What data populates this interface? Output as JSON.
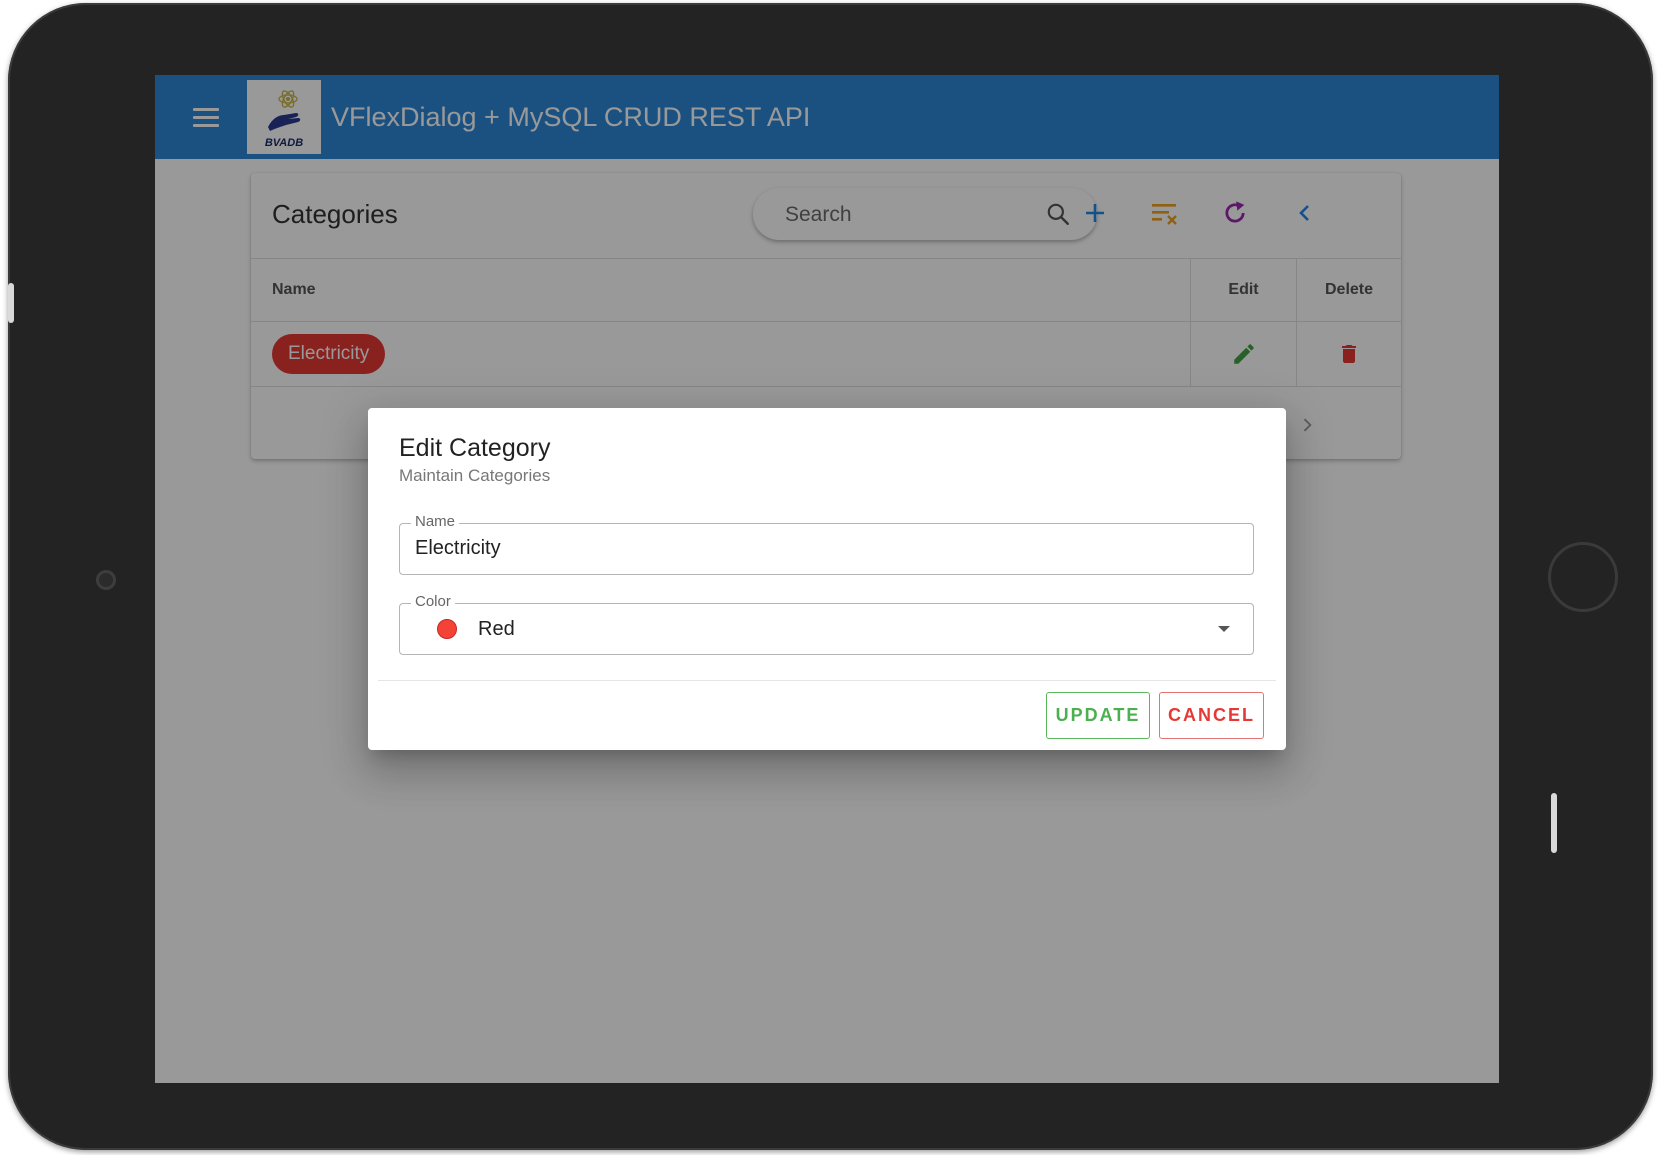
{
  "app_bar": {
    "title": "VFlexDialog + MySQL CRUD REST API",
    "logo_text": "BVADB",
    "accent": "#2e88d6"
  },
  "card": {
    "title": "Categories",
    "search": {
      "placeholder": "Search",
      "value": ""
    },
    "toolbar_icons": [
      "add-icon",
      "filter-clear-icon",
      "refresh-icon",
      "chevron-left-icon"
    ],
    "table": {
      "columns": {
        "name": "Name",
        "edit": "Edit",
        "delete": "Delete"
      },
      "rows": [
        {
          "name": "Electricity",
          "color": "#e53935"
        }
      ]
    }
  },
  "dialog": {
    "title": "Edit Category",
    "subtitle": "Maintain Categories",
    "name_field": {
      "label": "Name",
      "value": "Electricity"
    },
    "color_field": {
      "label": "Color",
      "value": "Red",
      "swatch": "#f44336"
    },
    "update_label": "UPDATE",
    "cancel_label": "CANCEL",
    "update_color": "#4caf50",
    "cancel_color": "#e53935"
  }
}
